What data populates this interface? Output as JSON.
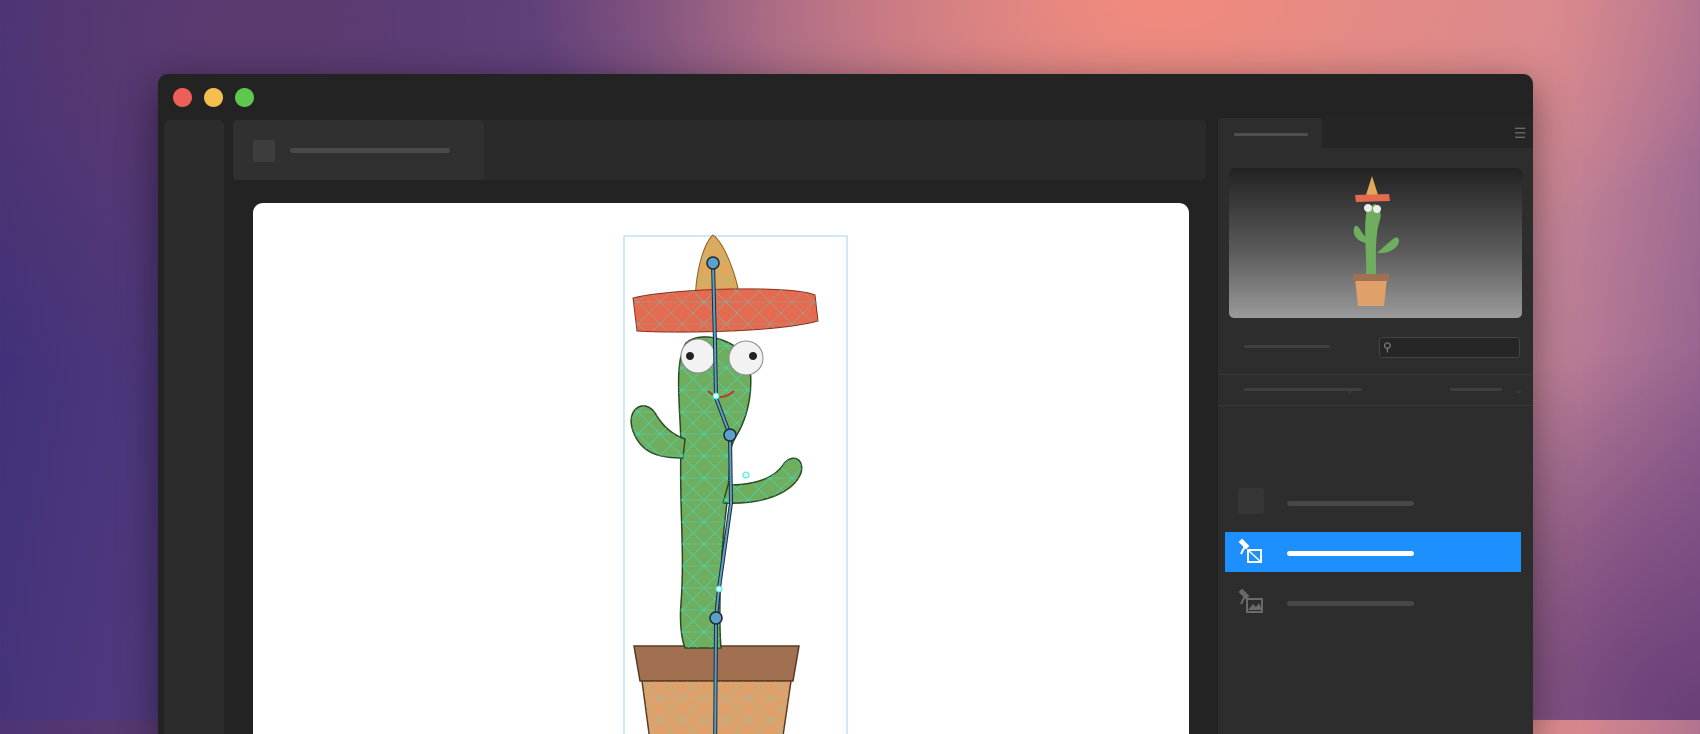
{
  "app": {
    "window_controls": [
      "close",
      "minimize",
      "maximize"
    ]
  },
  "panel": {
    "menu_icon": "hamburger-menu-icon",
    "search": {
      "value": "",
      "placeholder": ""
    }
  },
  "layers": [
    {
      "icon": "folder-thumbnail-icon",
      "selected": false
    },
    {
      "icon": "pin-warp-icon",
      "selected": true
    },
    {
      "icon": "image-layer-icon",
      "selected": false
    }
  ],
  "colors": {
    "selection": "#1e8fff",
    "mesh": "#3fe6d8",
    "bone": "#1f2a33",
    "joint": "#5aa0c8"
  }
}
